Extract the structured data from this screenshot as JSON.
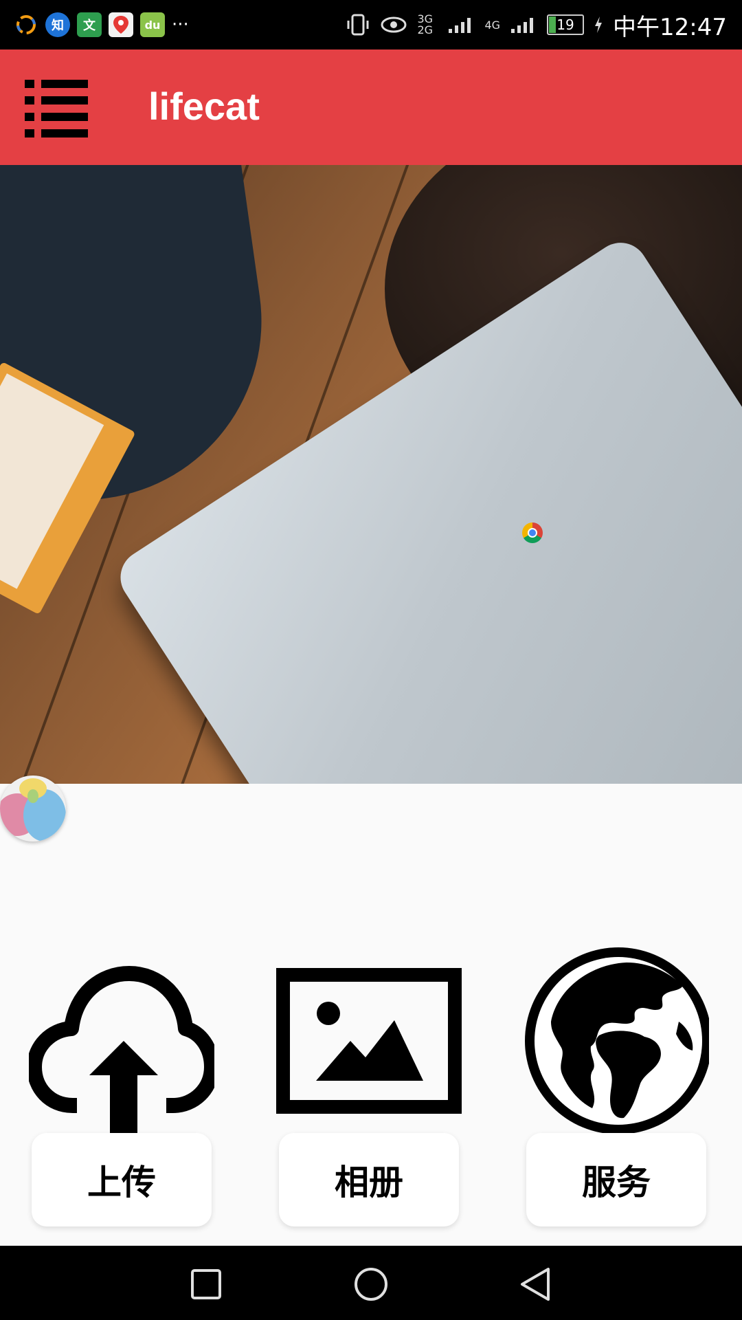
{
  "status_bar": {
    "time": "中午12:47",
    "battery": "19",
    "network_1": "3G 2G",
    "network_2": "4G",
    "more": "···",
    "notification_apps": [
      "circle-app-icon",
      "zhihu-icon",
      "wen-icon",
      "maps-icon",
      "baidu-du-icon"
    ],
    "notification_labels": {
      "zhihu": "知",
      "wen": "文",
      "du": "du"
    }
  },
  "app_bar": {
    "title": "lifecat",
    "color": "#e44044"
  },
  "features": [
    {
      "label": "上传",
      "icon": "cloud-upload-icon"
    },
    {
      "label": "相册",
      "icon": "image-gallery-icon"
    },
    {
      "label": "服务",
      "icon": "globe-icon"
    }
  ],
  "nav_bar": {
    "buttons": [
      "recents-square-icon",
      "home-circle-icon",
      "back-triangle-icon"
    ]
  }
}
